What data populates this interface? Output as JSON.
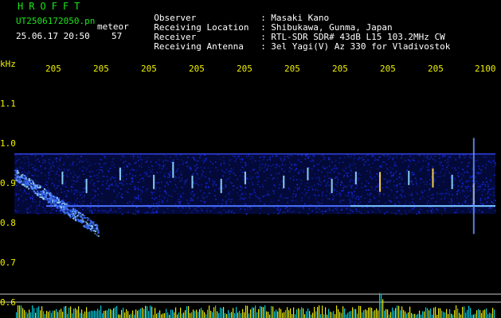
{
  "header": {
    "app_name": "HROFFT",
    "filename": "UT2506172050.pn",
    "tag": "meteor",
    "datetime": "25.06.17 20:50",
    "count": "57"
  },
  "station": [
    {
      "label": "Observer",
      "value": "Masaki Kano"
    },
    {
      "label": "Receiving Location",
      "value": "Shibukawa, Gunma, Japan"
    },
    {
      "label": "Receiver",
      "value": "RTL-SDR SDR# 43dB L15 103.2MHz CW"
    },
    {
      "label": "Receiving Antenna",
      "value": "3el Yagi(V) Az 330 for Vladivostok"
    }
  ],
  "colors": {
    "header_title": "#19e619",
    "tick_labels": "#f0f000",
    "background": "#000000",
    "noise_blue": "#1a2eff",
    "carrier": "#7fd0ff",
    "meteor_head": "#ffd84a"
  },
  "chart_data": {
    "type": "heatmap",
    "y_unit_label": "kHz",
    "x_tick_labels": [
      "205",
      "205",
      "205",
      "205",
      "205",
      "205",
      "205",
      "205",
      "205",
      "2100"
    ],
    "y_ticks": [
      {
        "value": 1.1,
        "label": "1.1"
      },
      {
        "value": 1.0,
        "label": "1.0"
      },
      {
        "value": 0.9,
        "label": "0.9"
      },
      {
        "value": 0.8,
        "label": "0.8"
      },
      {
        "value": 0.7,
        "label": "0.7"
      },
      {
        "value": 0.6,
        "label": "0.6"
      }
    ],
    "ylim": [
      0.57,
      1.17
    ],
    "xlim": [
      0,
      1
    ],
    "grid": false,
    "carrier_khz": 0.85,
    "noise_band_khz": [
      0.83,
      0.98
    ],
    "upper_line_khz": 0.98,
    "lower_line_khz": 0.81,
    "meteor_pings": [
      {
        "t": 0.1,
        "f": 0.92,
        "strength": 0.5
      },
      {
        "t": 0.15,
        "f": 0.9,
        "strength": 0.6
      },
      {
        "t": 0.22,
        "f": 0.93,
        "strength": 0.5
      },
      {
        "t": 0.29,
        "f": 0.91,
        "strength": 0.6
      },
      {
        "t": 0.33,
        "f": 0.94,
        "strength": 0.7
      },
      {
        "t": 0.37,
        "f": 0.91,
        "strength": 0.5
      },
      {
        "t": 0.43,
        "f": 0.9,
        "strength": 0.6
      },
      {
        "t": 0.48,
        "f": 0.92,
        "strength": 0.5
      },
      {
        "t": 0.56,
        "f": 0.91,
        "strength": 0.5
      },
      {
        "t": 0.61,
        "f": 0.93,
        "strength": 0.5
      },
      {
        "t": 0.66,
        "f": 0.9,
        "strength": 0.6
      },
      {
        "t": 0.71,
        "f": 0.92,
        "strength": 0.5
      },
      {
        "t": 0.76,
        "f": 0.91,
        "strength": 0.95
      },
      {
        "t": 0.82,
        "f": 0.92,
        "strength": 0.6
      },
      {
        "t": 0.87,
        "f": 0.92,
        "strength": 0.9
      },
      {
        "t": 0.91,
        "f": 0.91,
        "strength": 0.6
      },
      {
        "t": 0.955,
        "f": 0.88,
        "strength": 1.0
      }
    ]
  }
}
